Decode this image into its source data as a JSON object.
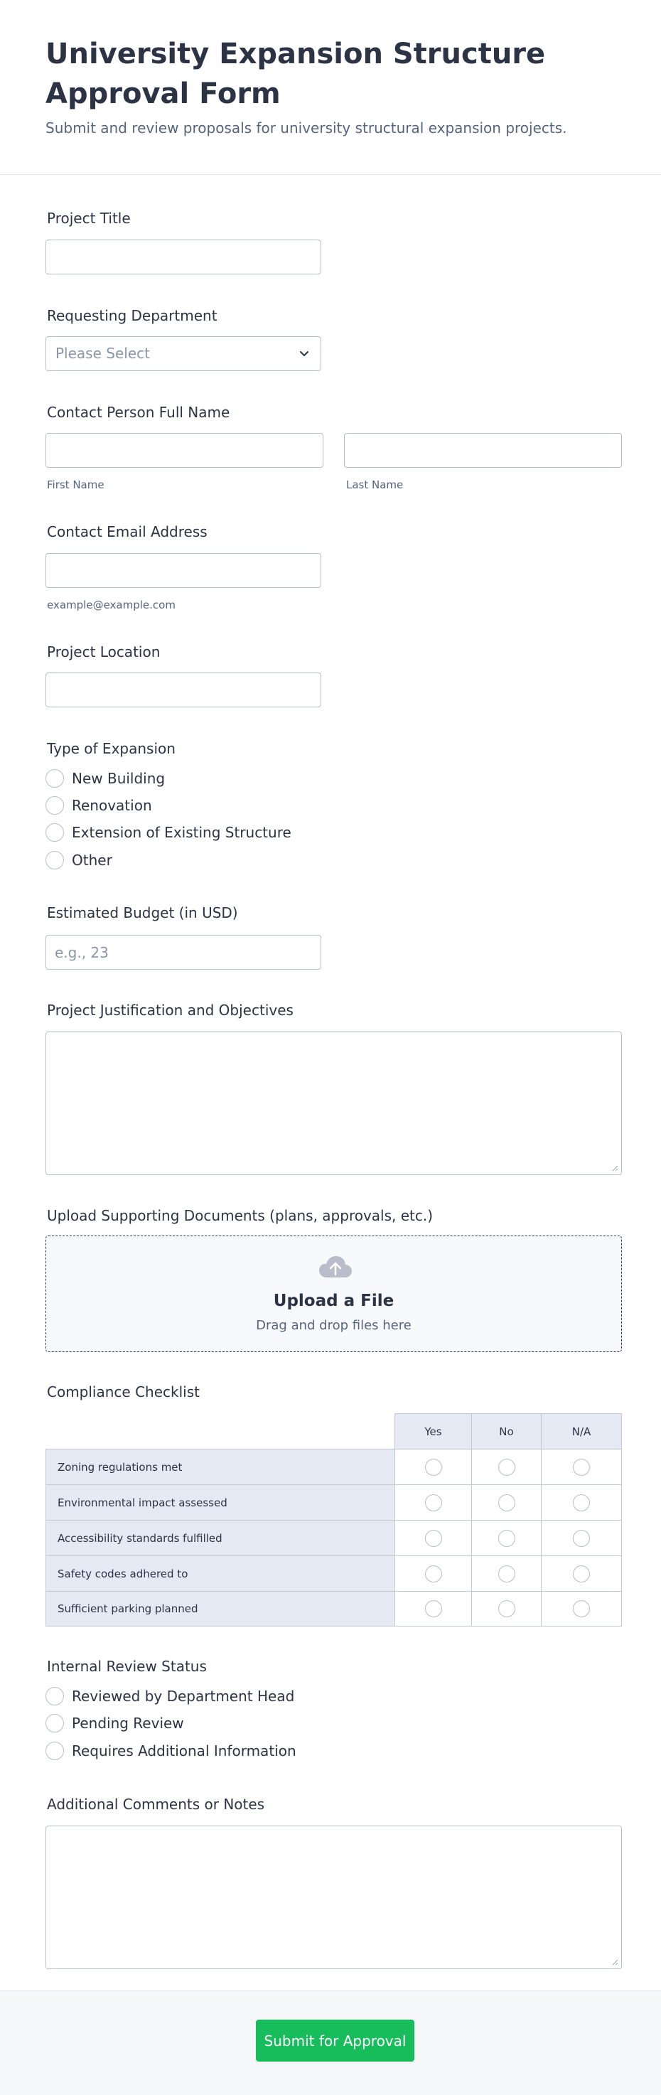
{
  "form": {
    "title": "University Expansion Structure Approval Form",
    "subtitle": "Submit and review proposals for university structural expansion projects."
  },
  "fields": {
    "project_title": {
      "label": "Project Title",
      "value": ""
    },
    "department": {
      "label": "Requesting Department",
      "selected": "Please Select"
    },
    "contact_name": {
      "label": "Contact Person Full Name",
      "first_sublabel": "First Name",
      "last_sublabel": "Last Name"
    },
    "email": {
      "label": "Contact Email Address",
      "sublabel": "example@example.com"
    },
    "location": {
      "label": "Project Location"
    },
    "expansion_type": {
      "label": "Type of Expansion",
      "options": [
        "New Building",
        "Renovation",
        "Extension of Existing Structure",
        "Other"
      ]
    },
    "budget": {
      "label": "Estimated Budget (in USD)",
      "placeholder": "e.g., 23"
    },
    "justification": {
      "label": "Project Justification and Objectives"
    },
    "upload": {
      "label": "Upload Supporting Documents (plans, approvals, etc.)",
      "title": "Upload a File",
      "subtitle": "Drag and drop files here"
    },
    "compliance": {
      "label": "Compliance Checklist",
      "columns": [
        "Yes",
        "No",
        "N/A"
      ],
      "rows": [
        "Zoning regulations met",
        "Environmental impact assessed",
        "Accessibility standards fulfilled",
        "Safety codes adhered to",
        "Sufficient parking planned"
      ]
    },
    "review_status": {
      "label": "Internal Review Status",
      "options": [
        "Reviewed by Department Head",
        "Pending Review",
        "Requires Additional Information"
      ]
    },
    "comments": {
      "label": "Additional Comments or Notes"
    }
  },
  "submit_label": "Submit for Approval",
  "colors": {
    "accent": "#18bd5b",
    "text": "#2c3345",
    "muted": "#57647e",
    "border": "#b8bdc9",
    "matrix_header": "#e5e9f3"
  }
}
